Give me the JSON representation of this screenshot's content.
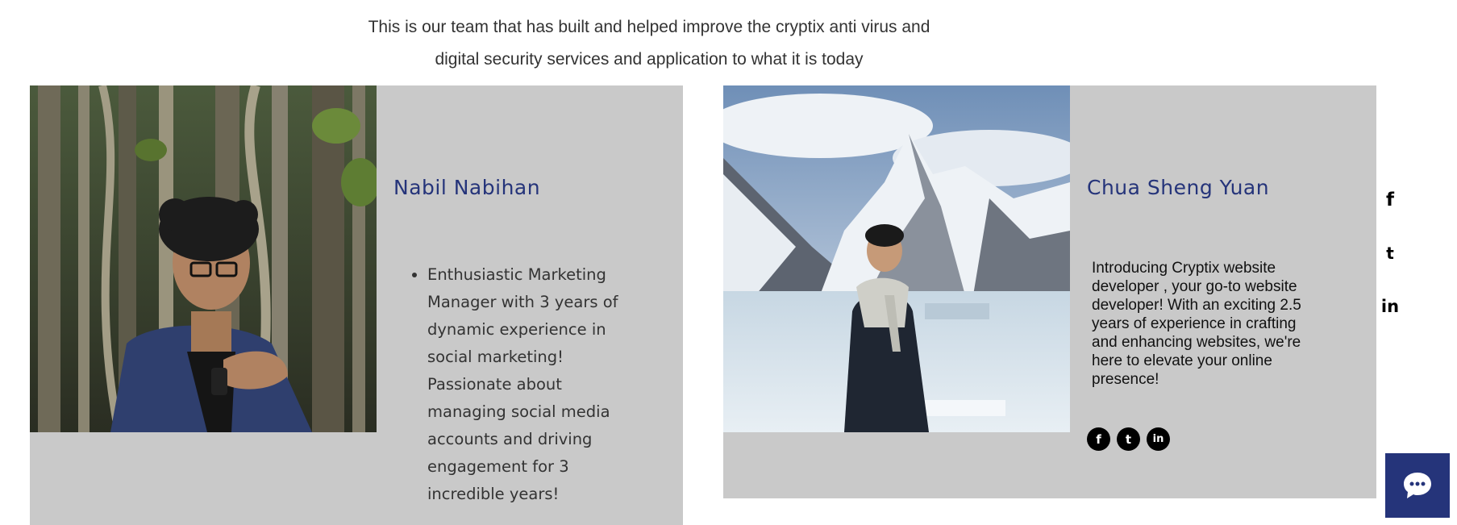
{
  "intro": {
    "line1": "This is our team that has built and helped improve the cryptix anti virus and",
    "line2": "digital security services and application to what it is today"
  },
  "members": [
    {
      "name": "Nabil Nabihan",
      "bio_lines": [
        "Enthusiastic Marketing",
        "Manager with 3 years of",
        "dynamic experience in",
        "social marketing!",
        "Passionate about",
        "managing social media",
        "accounts and driving",
        "engagement for 3",
        "incredible years!"
      ]
    },
    {
      "name": "Chua Sheng Yuan",
      "bio_lines": [
        "Introducing Cryptix website",
        "developer , your go-to website",
        "developer! With an exciting 2.5",
        "years of experience in crafting",
        "and enhancing websites, we're",
        "here to elevate your online",
        "presence!"
      ],
      "social": [
        "f",
        "t",
        "in"
      ]
    }
  ],
  "sidebar_social": [
    "f",
    "t",
    "in"
  ],
  "icons": {
    "facebook": "facebook-icon",
    "twitter": "twitter-icon",
    "linkedin": "linkedin-icon",
    "chat": "chat-icon"
  },
  "colors": {
    "name": "#25347a",
    "card_bg": "#c9c9c9",
    "chat_bg": "#25347a"
  }
}
